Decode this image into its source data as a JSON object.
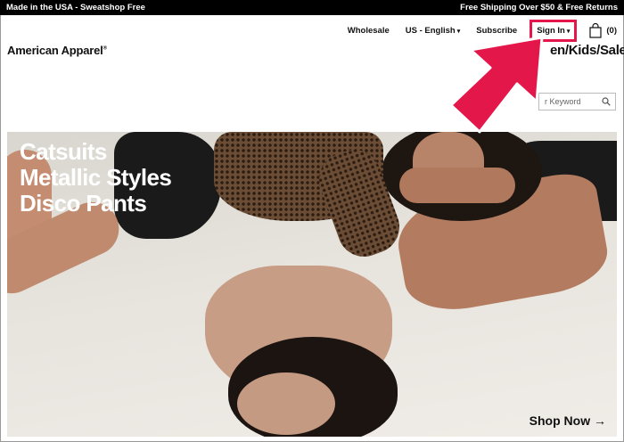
{
  "promo": {
    "left": "Made in the USA - Sweatshop Free",
    "right": "Free Shipping Over $50 & Free Returns"
  },
  "utility_nav": {
    "wholesale": "Wholesale",
    "locale": "US - English",
    "subscribe": "Subscribe",
    "sign_in": "Sign In",
    "bag_count": "(0)"
  },
  "brand": {
    "logo": "American Apparel",
    "reg_mark": "®"
  },
  "main_nav": {
    "visible_text": "en/Kids/Sale"
  },
  "search": {
    "placeholder": "r Keyword"
  },
  "hero": {
    "headlines": [
      "Catsuits",
      "Metallic Styles",
      "Disco Pants"
    ],
    "cta": "Shop Now"
  },
  "colors": {
    "highlight": "#e4174a",
    "promo_bg": "#000000"
  },
  "icons": {
    "bag": "shopping-bag-icon",
    "search": "search-icon",
    "caret": "caret-down-icon",
    "cta_arrow": "arrow-right-icon"
  }
}
